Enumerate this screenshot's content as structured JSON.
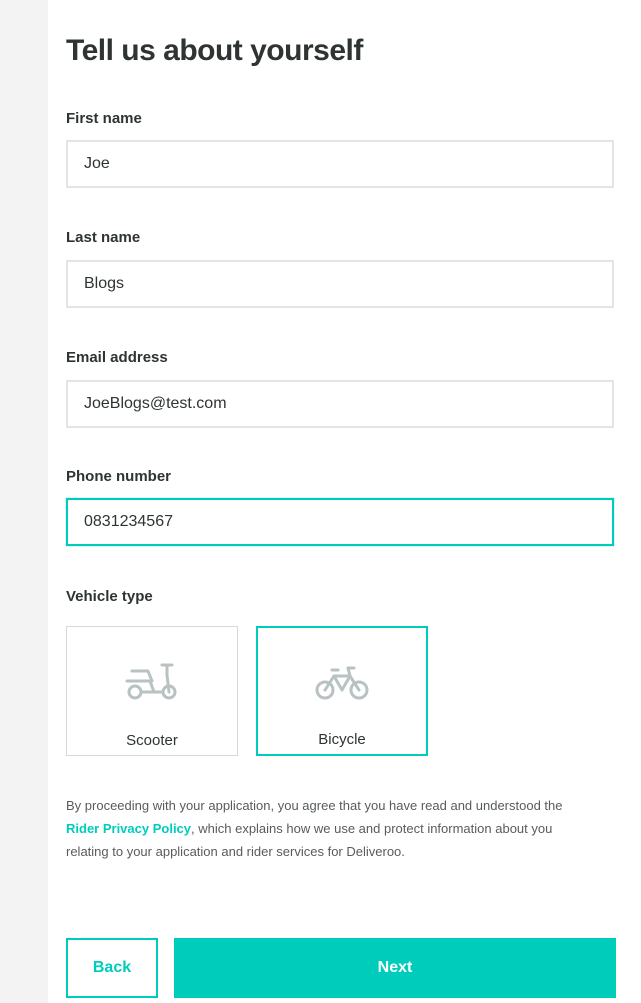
{
  "page": {
    "title": "Tell us about yourself"
  },
  "form": {
    "first_name": {
      "label": "First name",
      "value": "Joe"
    },
    "last_name": {
      "label": "Last name",
      "value": "Blogs"
    },
    "email": {
      "label": "Email address",
      "value": "JoeBlogs@test.com"
    },
    "phone": {
      "label": "Phone number",
      "value": "0831234567"
    }
  },
  "vehicle": {
    "label": "Vehicle type",
    "options": [
      {
        "label": "Scooter",
        "icon": "scooter-icon",
        "selected": false
      },
      {
        "label": "Bicycle",
        "icon": "bicycle-icon",
        "selected": true
      }
    ]
  },
  "consent": {
    "prefix": "By proceeding with your application, you agree that you have read and understood the ",
    "link": "Rider Privacy Policy",
    "suffix": ", which explains how we use and protect information about you relating to your application and rider services for Deliveroo."
  },
  "buttons": {
    "back": "Back",
    "next": "Next"
  },
  "colors": {
    "accent": "#00ccbc",
    "text": "#2e3333",
    "border": "#e4e4e4",
    "icon": "#b8c2c2"
  }
}
